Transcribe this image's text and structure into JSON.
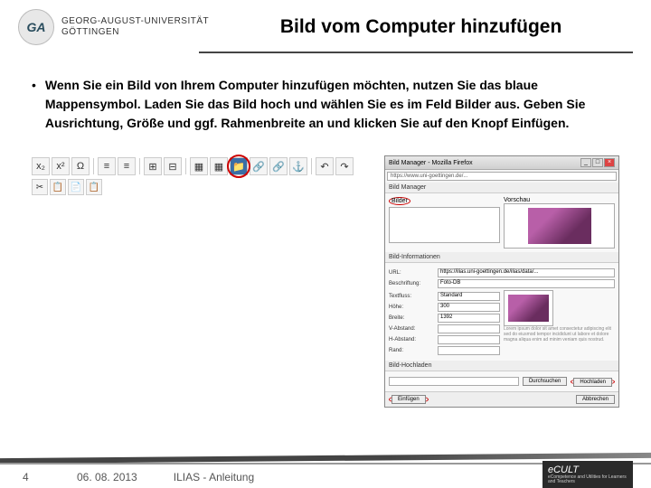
{
  "header": {
    "logo_text": "GA",
    "uni_line1": "GEORG-AUGUST-UNIVERSITÄT",
    "uni_line2": "GÖTTINGEN",
    "title": "Bild vom Computer hinzufügen"
  },
  "content": {
    "bullet": "•",
    "text": "Wenn Sie ein Bild von Ihrem Computer hinzufügen möchten, nutzen Sie das blaue Mappensymbol. Laden Sie das Bild hoch und wählen Sie es im Feld Bilder aus. Geben Sie Ausrichtung, Größe und ggf. Rahmenbreite an und klicken Sie auf den Knopf Einfügen."
  },
  "toolbar": {
    "icons_row1": [
      "x₂",
      "x²",
      "Ω",
      "≡",
      "≡",
      "⊞",
      "⊟",
      "▦",
      "▦"
    ],
    "icons_row1_circled": "📁",
    "icons_row1_after": [
      "🔗",
      "🔗",
      "⚓",
      "↶",
      "↷"
    ],
    "icons_row2": [
      "✂",
      "📋",
      "📄",
      "📋"
    ]
  },
  "dialog": {
    "title": "Bild Manager - Mozilla Firefox",
    "url": "https://www.uni-goettingen.de/...",
    "tab_header": "Bild Manager",
    "section_bilder": "Bilder",
    "section_vorschau": "Vorschau",
    "section_info": "Bild-Informationen",
    "labels": {
      "url": "URL:",
      "beschriftung": "Beschriftung:",
      "textfluss": "Textfluss:",
      "hoehe": "Höhe:",
      "breite": "Breite:",
      "vabstand": "V-Abstand:",
      "habstand": "H-Abstand:",
      "rand": "Rand:"
    },
    "values": {
      "url": "https://ilias.uni-goettingen.de/ilias/data/...",
      "beschriftung": "Foto-DB",
      "textfluss": "Standard",
      "hoehe": "300",
      "breite": "1392"
    },
    "section_upload": "Bild-Hochladen",
    "btn_durchsuchen": "Durchsuchen",
    "btn_hochladen": "Hochladen",
    "btn_einfuegen": "Einfügen",
    "btn_abbrechen": "Abbrechen"
  },
  "footer": {
    "page": "4",
    "date": "06. 08. 2013",
    "doc_title": "ILIAS - Anleitung",
    "ecult": "eCULT",
    "ecult_sub": "eCompetence and Utilities for Learners and Teachers"
  }
}
